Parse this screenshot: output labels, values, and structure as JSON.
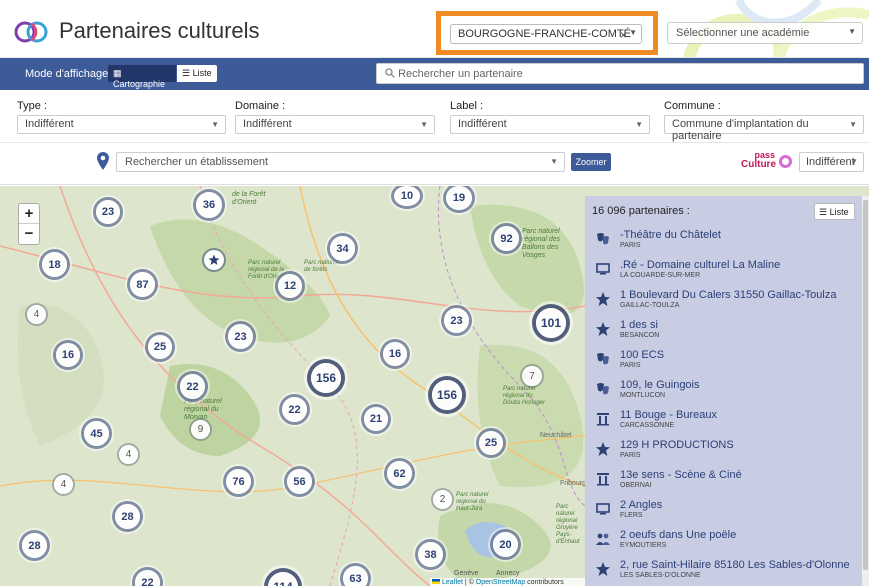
{
  "header": {
    "app_title": "Partenaires culturels",
    "region_select": {
      "value": "BOURGOGNE-FRANCHE-COMTÉ",
      "clear_symbol": "×"
    },
    "academy_select": {
      "placeholder": "Sélectionner une académie"
    },
    "highlight_color": "#f08a24"
  },
  "modebar": {
    "label": "Mode d'affichage :",
    "carto_label": "Cartographie",
    "liste_label": "Liste",
    "search_placeholder": "Rechercher un partenaire",
    "bar_color": "#3d5a99"
  },
  "filters": {
    "type": {
      "label": "Type :",
      "value": "Indifférent"
    },
    "domaine": {
      "label": "Domaine :",
      "value": "Indifférent"
    },
    "label": {
      "label": "Label :",
      "value": "Indifférent"
    },
    "commune": {
      "label": "Commune :",
      "value": "Commune d'implantation du partenaire"
    },
    "etablissement_placeholder": "Rechercher un établissement",
    "zoom_button": "Zoomer",
    "pass_culture": {
      "line1": "pass",
      "line2": "Culture",
      "value": "Indifférent"
    }
  },
  "map": {
    "zoom_in": "+",
    "zoom_out": "−",
    "clusters": [
      "36",
      "10",
      "19",
      "23",
      "34",
      "92",
      "18",
      "87",
      "12",
      "4",
      "23",
      "101",
      "25",
      "23",
      "16",
      "16",
      "156",
      "7",
      "22",
      "156",
      "22",
      "21",
      "9",
      "45",
      "25",
      "4",
      "76",
      "56",
      "62",
      "4",
      "2",
      "28",
      "20",
      "38",
      "28",
      "22",
      "114",
      "63"
    ],
    "place_labels": [
      "de la Forêt d'Orient",
      "Parc naturel régional des Ballons des Vosges",
      "Parc naturel régional de la Forêt d'Orient",
      "Parc national de forêts",
      "Parc naturel régional du Morvan",
      "Parc naturel régional du Doubs Horloger",
      "Parc naturel régional du Haut-Jura",
      "Parc naturel régional Gruyère Pays-d'Enhaut",
      "Neuchâtel",
      "Fribourg",
      "Genève",
      "Annecy"
    ],
    "attribution": {
      "leaflet": "Leaflet",
      "separator": " | © ",
      "osm": "OpenStreetMap",
      "suffix": " contributors"
    }
  },
  "panel": {
    "count": "16 096 partenaires :",
    "list_button": "Liste",
    "items": [
      {
        "name": "-Théâtre du Châtelet",
        "city": "PARIS",
        "icon": "theater-masks-icon"
      },
      {
        "name": ".Ré - Domaine culturel La Maline",
        "city": "LA COUARDE-SUR-MER",
        "icon": "screen-icon"
      },
      {
        "name": "1 Boulevard Du Calers 31550 Gaillac-Toulza",
        "city": "GAILLAC-TOULZA",
        "icon": "star-icon"
      },
      {
        "name": "1 des si",
        "city": "BESANCON",
        "icon": "star-icon"
      },
      {
        "name": "100 ECS",
        "city": "PARIS",
        "icon": "theater-masks-icon"
      },
      {
        "name": "109, le Guingois",
        "city": "MONTLUCON",
        "icon": "theater-masks-icon"
      },
      {
        "name": "11 Bouge - Bureaux",
        "city": "CARCASSONNE",
        "icon": "museum-icon"
      },
      {
        "name": "129 H PRODUCTIONS",
        "city": "PARIS",
        "icon": "star-icon"
      },
      {
        "name": "13e sens - Scène & Ciné",
        "city": "OBERNAI",
        "icon": "museum-icon"
      },
      {
        "name": "2 Angles",
        "city": "FLERS",
        "icon": "screen-icon"
      },
      {
        "name": "2 oeufs dans Une poële",
        "city": "EYMOUTIERS",
        "icon": "people-icon"
      },
      {
        "name": "2, rue Saint-Hilaire 85180 Les Sables-d'Olonne",
        "city": "LES SABLES-D'OLONNE",
        "icon": "star-icon"
      }
    ]
  }
}
